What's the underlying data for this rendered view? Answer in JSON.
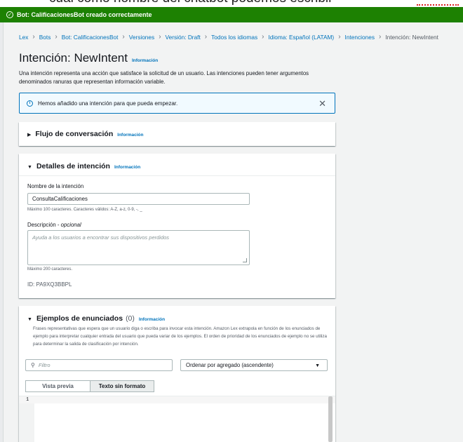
{
  "doc_overlay_text": "cual como nombre del chatbot podemos escribir",
  "flash": {
    "message": "Bot: CalificacionesBot creado correctamente"
  },
  "breadcrumb": [
    "Lex",
    "Bots",
    "Bot: CalificacionesBot",
    "Versiones",
    "Versión: Draft",
    "Todos los idiomas",
    "Idioma: Español (LATAM)",
    "Intenciones",
    "Intención: NewIntent"
  ],
  "page": {
    "title": "Intención: NewIntent",
    "info": "Información",
    "description": "Una intención representa una acción que satisface la solicitud de un usuario. Las intenciones pueden tener argumentos denominados ranuras que representan información variable."
  },
  "alert": {
    "text": "Hemos añadido una intención para que pueda empezar.",
    "close": "✕"
  },
  "conversation_flow": {
    "title": "Flujo de conversación",
    "info": "Información"
  },
  "intent_details": {
    "title": "Detalles de intención",
    "info": "Información",
    "name_label": "Nombre de la intención",
    "name_value": "ConsultaCalificaciones",
    "name_hint": "Máximo 100 caracteres. Caracteres válidos: A-Z, a-z, 0-9, -, _",
    "desc_label": "Descripción",
    "desc_optional": "opcional",
    "desc_placeholder": "Ayuda a los usuarios a encontrar sus dispositivos perdidos",
    "desc_hint": "Máximo 200 caracteres.",
    "id_text": "ID: PA9XQ3BBPL"
  },
  "utterances": {
    "title": "Ejemplos de enunciados",
    "count": "(0)",
    "info": "Información",
    "description": "Frases representativas que espera que un usuario diga o escriba para invocar esta intención. Amazon Lex extrapola en función de los enunciados de ejemplo para interpretar cualquier entrada del usuario que pueda variar de los ejemplos. El orden de prioridad de los enunciados de ejemplo no se utiliza para determinar la salida de clasificación por intención.",
    "filter_placeholder": "Filtro",
    "sort_value": "Ordenar por agregado (ascendente)",
    "tab_preview": "Vista previa",
    "tab_raw": "Texto sin formato",
    "line_number": "1"
  },
  "colors": {
    "flash": "#1d8102",
    "link": "#0073bb",
    "alert_bg": "#f1faff"
  }
}
